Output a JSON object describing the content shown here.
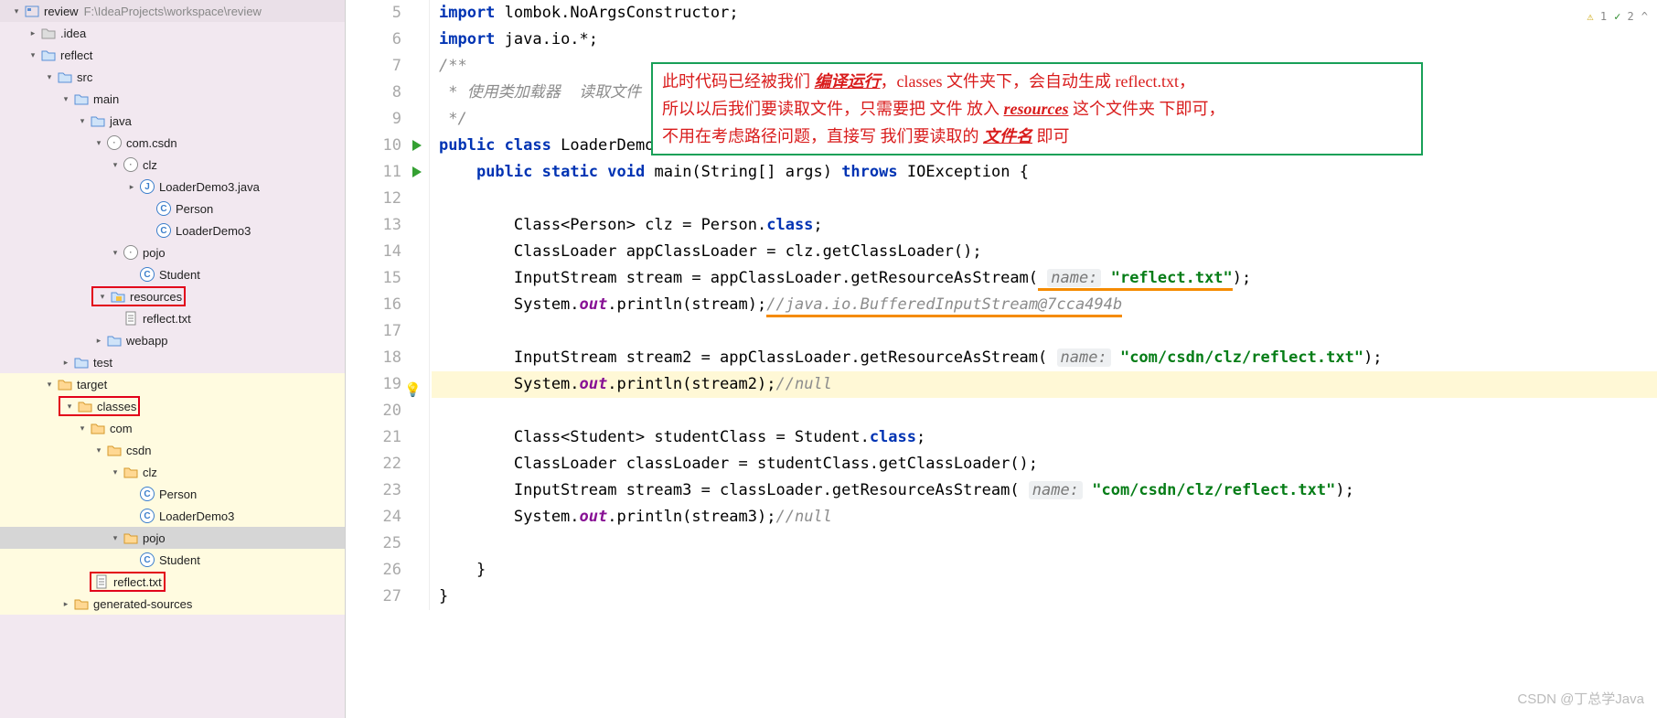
{
  "project": {
    "root": "review",
    "root_path": "F:\\IdeaProjects\\workspace\\review"
  },
  "tree": [
    {
      "d": 0,
      "exp": "v",
      "ic": "mod",
      "t": "review",
      "extra": "F:\\IdeaProjects\\workspace\\review"
    },
    {
      "d": 1,
      "exp": ">",
      "ic": "fld",
      "t": ".idea"
    },
    {
      "d": 1,
      "exp": "v",
      "ic": "fld-b",
      "t": "reflect"
    },
    {
      "d": 2,
      "exp": "v",
      "ic": "fld-b",
      "t": "src"
    },
    {
      "d": 3,
      "exp": "v",
      "ic": "fld-b",
      "t": "main"
    },
    {
      "d": 4,
      "exp": "v",
      "ic": "fld-b",
      "t": "java"
    },
    {
      "d": 5,
      "exp": "v",
      "ic": "pkg",
      "t": "com.csdn"
    },
    {
      "d": 6,
      "exp": "v",
      "ic": "pkg",
      "t": "clz"
    },
    {
      "d": 7,
      "exp": ">",
      "ic": "jcls",
      "t": "LoaderDemo3.java"
    },
    {
      "d": 8,
      "exp": "",
      "ic": "cls",
      "t": "Person"
    },
    {
      "d": 8,
      "exp": "",
      "ic": "cls",
      "t": "LoaderDemo3"
    },
    {
      "d": 6,
      "exp": "v",
      "ic": "pkg",
      "t": "pojo"
    },
    {
      "d": 7,
      "exp": "",
      "ic": "cls",
      "t": "Student"
    },
    {
      "d": 5,
      "exp": "v",
      "ic": "res",
      "t": "resources",
      "hl": 1,
      "wrap": 1
    },
    {
      "d": 6,
      "exp": "",
      "ic": "txt",
      "t": "reflect.txt"
    },
    {
      "d": 5,
      "exp": ">",
      "ic": "fld-b",
      "t": "webapp"
    },
    {
      "d": 3,
      "exp": ">",
      "ic": "fld-b",
      "t": "test"
    },
    {
      "d": 2,
      "exp": "v",
      "ic": "fld-o",
      "t": "target",
      "yz": 1
    },
    {
      "d": 3,
      "exp": "v",
      "ic": "fld-o",
      "t": "classes",
      "hl": 1,
      "wrap": 1,
      "yz": 1
    },
    {
      "d": 4,
      "exp": "v",
      "ic": "fld-o",
      "t": "com",
      "yz": 1
    },
    {
      "d": 5,
      "exp": "v",
      "ic": "fld-o",
      "t": "csdn",
      "yz": 1
    },
    {
      "d": 6,
      "exp": "v",
      "ic": "fld-o",
      "t": "clz",
      "yz": 1
    },
    {
      "d": 7,
      "exp": "",
      "ic": "cls",
      "t": "Person",
      "yz": 1
    },
    {
      "d": 7,
      "exp": "",
      "ic": "cls",
      "t": "LoaderDemo3",
      "yz": 1
    },
    {
      "d": 6,
      "exp": "v",
      "ic": "fld-o",
      "t": "pojo",
      "sel": 1,
      "yz": 1
    },
    {
      "d": 7,
      "exp": "",
      "ic": "cls",
      "t": "Student",
      "yz": 1
    },
    {
      "d": 4,
      "exp": "",
      "ic": "txt",
      "t": "reflect.txt",
      "hl": 1,
      "yz": 1
    },
    {
      "d": 3,
      "exp": ">",
      "ic": "fld-o",
      "t": "generated-sources",
      "yz": 1
    }
  ],
  "code": {
    "start": 5,
    "run_markers": [
      10,
      11
    ],
    "bulb_markers": [
      19
    ],
    "hl_lines": [
      19
    ],
    "lines": [
      {
        "n": 5,
        "h": "<span class='kw'>import</span> lombok.<span class='cls'>NoArgsConstructor</span>;"
      },
      {
        "n": 6,
        "h": "<span class='kw'>import</span> java.io.*;"
      },
      {
        "n": 7,
        "h": "<span class='cmt'>/**</span>"
      },
      {
        "n": 8,
        "h": "<span class='cmt'> * 使用类加载器  读取文件</span>"
      },
      {
        "n": 9,
        "h": "<span class='cmt'> */</span>"
      },
      {
        "n": 10,
        "h": "<span class='kw'>public</span> <span class='kw'>class</span> LoaderDemo3 {"
      },
      {
        "n": 11,
        "h": "    <span class='kw'>public</span> <span class='kw'>static</span> <span class='kw2'>void</span> main(String[] args) <span class='kw'>throws</span> <span class='cls'>IOException</span> {"
      },
      {
        "n": 12,
        "h": ""
      },
      {
        "n": 13,
        "h": "        Class&lt;Person&gt; clz = Person.<span class='kw'>class</span>;"
      },
      {
        "n": 14,
        "h": "        ClassLoader appClassLoader = clz.getClassLoader();"
      },
      {
        "n": 15,
        "h": "        InputStream stream = appClassLoader.getResourceAsStream(<span class='u-orange'> <span class='hint'>name:</span> <span class='str'>\"reflect.txt\"</span></span>);"
      },
      {
        "n": 16,
        "h": "        System.<span class='fld'>out</span>.println(stream);<span class='u-orange'><span class='cmt'>//java.io.BufferedInputStream@7cca494b</span></span>"
      },
      {
        "n": 17,
        "h": ""
      },
      {
        "n": 18,
        "h": "        InputStream stream2 = appClassLoader.getResourceAsStream( <span class='hint'>name:</span> <span class='str'>\"com/csdn/clz/reflect.txt\"</span>);"
      },
      {
        "n": 19,
        "h": "        System.<span class='fld'>out</span>.println(stream2);<span class='cmt'>//null</span>"
      },
      {
        "n": 20,
        "h": ""
      },
      {
        "n": 21,
        "h": "        Class&lt;Student&gt; studentClass = Student.<span class='kw'>class</span>;"
      },
      {
        "n": 22,
        "h": "        ClassLoader classLoader = studentClass.getClassLoader();"
      },
      {
        "n": 23,
        "h": "        InputStream stream3 = classLoader.getResourceAsStream( <span class='hint'>name:</span> <span class='str'>\"com/csdn/clz/reflect.txt\"</span>);"
      },
      {
        "n": 24,
        "h": "        System.<span class='fld'>out</span>.println(stream3);<span class='cmt'>//null</span>"
      },
      {
        "n": 25,
        "h": ""
      },
      {
        "n": 26,
        "h": "    }"
      },
      {
        "n": 27,
        "h": "}"
      }
    ]
  },
  "annotation": {
    "l1_a": "此时代码已经被我们 ",
    "l1_b": "编译运行",
    "l1_c": "，classes 文件夹下，会自动生成 reflect.txt，",
    "l2_a": "所以以后我们要读取文件，只需要把 文件 放入 ",
    "l2_b": "resources",
    "l2_c": " 这个文件夹 下即可，",
    "l3_a": "不用在考虑路径问题，直接写 我们要读取的 ",
    "l3_b": "文件名",
    "l3_c": " 即可"
  },
  "inspections": {
    "warn_sym": "⚠",
    "warn": "1",
    "ok_sym": "✓",
    "ok": "2",
    "more": "^"
  },
  "watermark": "CSDN @丁总学Java"
}
